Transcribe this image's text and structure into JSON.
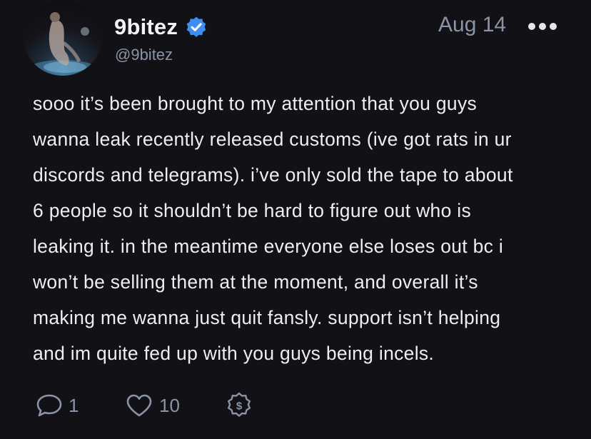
{
  "post": {
    "author": {
      "display_name": "9bitez",
      "handle": "@9bitez",
      "verified": true
    },
    "date": "Aug 14",
    "body_lines": [
      "sooo it’s been brought to my attention that you guys",
      "wanna leak recently released customs (ive got rats in ur",
      "discords and telegrams). i’ve only sold the tape to about",
      "6 people so it shouldn’t be hard to figure out who is",
      "leaking it. in the meantime everyone else loses out bc i",
      "won’t be selling them at the moment, and overall it’s",
      "making me wanna just quit fansly. support isn’t helping",
      "and im quite fed up with you guys being incels."
    ],
    "actions": {
      "comments": {
        "icon": "comment-icon",
        "count": "1"
      },
      "likes": {
        "icon": "heart-icon",
        "count": "10"
      },
      "tip": {
        "icon": "tip-dollar-icon"
      }
    }
  },
  "colors": {
    "background": "#121216",
    "text": "#eceef2",
    "muted": "#8a94a6",
    "verified_badge": "#3d8ef0"
  }
}
